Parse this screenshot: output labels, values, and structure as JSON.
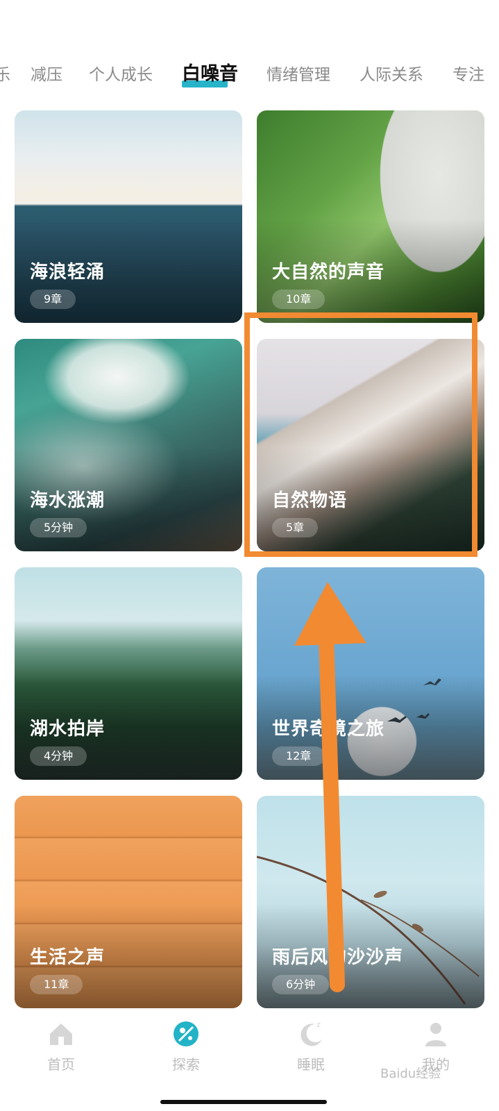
{
  "tabs": [
    {
      "label": "乐"
    },
    {
      "label": "减压"
    },
    {
      "label": "个人成长"
    },
    {
      "label": "白噪音",
      "active": true
    },
    {
      "label": "情绪管理"
    },
    {
      "label": "人际关系"
    },
    {
      "label": "专注"
    }
  ],
  "cards": [
    {
      "title": "海浪轻涌",
      "meta": "9章"
    },
    {
      "title": "大自然的声音",
      "meta": "10章"
    },
    {
      "title": "海水涨潮",
      "meta": "5分钟"
    },
    {
      "title": "自然物语",
      "meta": "5章"
    },
    {
      "title": "湖水拍岸",
      "meta": "4分钟"
    },
    {
      "title": "世界奇境之旅",
      "meta": "12章"
    },
    {
      "title": "生活之声",
      "meta": "11章"
    },
    {
      "title": "雨后风的沙沙声",
      "meta": "6分钟"
    }
  ],
  "nav": [
    {
      "label": "首页",
      "icon": "home-icon"
    },
    {
      "label": "探索",
      "icon": "compass-icon",
      "active": true
    },
    {
      "label": "睡眠",
      "icon": "moon-icon"
    },
    {
      "label": "我的",
      "icon": "user-icon"
    }
  ],
  "watermark": "Baidu经验",
  "colors": {
    "accent": "#22b3c7",
    "annotation": "#f28a32"
  }
}
